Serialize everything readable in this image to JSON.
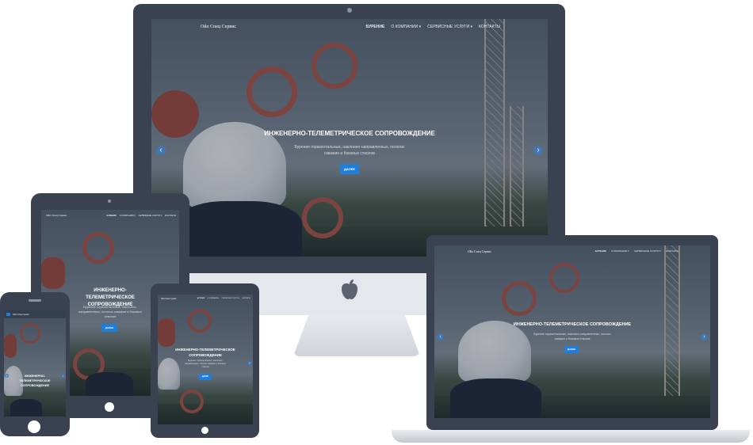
{
  "site": {
    "brand": "Ойл Спец Сервис",
    "menu": [
      "БУРЕНИЕ",
      "О КОМПАНИИ ▾",
      "СЕРВИСНЫЕ УСЛУГИ ▾",
      "КОНТАКТЫ"
    ],
    "hero_title": "ИНЖЕНЕРНО-ТЕЛЕМЕТРИЧЕСКОЕ СОПРОВОЖДЕНИЕ",
    "hero_subtitle": "Бурение горизонтальных, наклонно-направленных, пологих скважин и боковых стволов",
    "cta": "ДАЛЕЕ",
    "prev_arrow": "‹",
    "next_arrow": "›"
  },
  "devices": [
    "desktop-monitor",
    "tablet-landscape",
    "laptop",
    "tablet-portrait",
    "phone"
  ],
  "icons": {
    "apple": "apple-logo-icon"
  },
  "colors": {
    "frame": "#3a4150",
    "accent": "#1f7fd8",
    "silver": "#e1e4ea"
  }
}
